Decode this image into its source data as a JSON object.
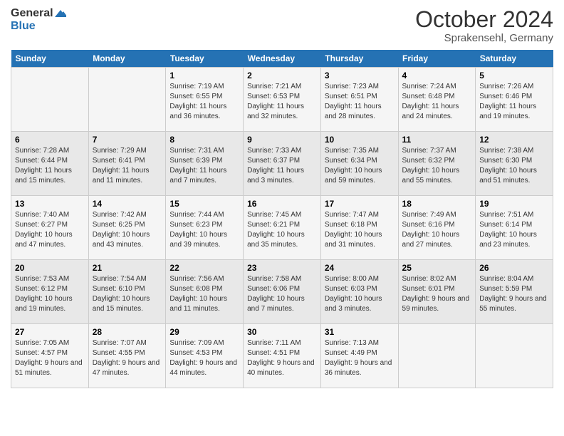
{
  "header": {
    "logo_line1": "General",
    "logo_line2": "Blue",
    "title": "October 2024",
    "subtitle": "Sprakensehl, Germany"
  },
  "days_of_week": [
    "Sunday",
    "Monday",
    "Tuesday",
    "Wednesday",
    "Thursday",
    "Friday",
    "Saturday"
  ],
  "weeks": [
    [
      {
        "day": "",
        "info": ""
      },
      {
        "day": "",
        "info": ""
      },
      {
        "day": "1",
        "info": "Sunrise: 7:19 AM\nSunset: 6:55 PM\nDaylight: 11 hours and 36 minutes."
      },
      {
        "day": "2",
        "info": "Sunrise: 7:21 AM\nSunset: 6:53 PM\nDaylight: 11 hours and 32 minutes."
      },
      {
        "day": "3",
        "info": "Sunrise: 7:23 AM\nSunset: 6:51 PM\nDaylight: 11 hours and 28 minutes."
      },
      {
        "day": "4",
        "info": "Sunrise: 7:24 AM\nSunset: 6:48 PM\nDaylight: 11 hours and 24 minutes."
      },
      {
        "day": "5",
        "info": "Sunrise: 7:26 AM\nSunset: 6:46 PM\nDaylight: 11 hours and 19 minutes."
      }
    ],
    [
      {
        "day": "6",
        "info": "Sunrise: 7:28 AM\nSunset: 6:44 PM\nDaylight: 11 hours and 15 minutes."
      },
      {
        "day": "7",
        "info": "Sunrise: 7:29 AM\nSunset: 6:41 PM\nDaylight: 11 hours and 11 minutes."
      },
      {
        "day": "8",
        "info": "Sunrise: 7:31 AM\nSunset: 6:39 PM\nDaylight: 11 hours and 7 minutes."
      },
      {
        "day": "9",
        "info": "Sunrise: 7:33 AM\nSunset: 6:37 PM\nDaylight: 11 hours and 3 minutes."
      },
      {
        "day": "10",
        "info": "Sunrise: 7:35 AM\nSunset: 6:34 PM\nDaylight: 10 hours and 59 minutes."
      },
      {
        "day": "11",
        "info": "Sunrise: 7:37 AM\nSunset: 6:32 PM\nDaylight: 10 hours and 55 minutes."
      },
      {
        "day": "12",
        "info": "Sunrise: 7:38 AM\nSunset: 6:30 PM\nDaylight: 10 hours and 51 minutes."
      }
    ],
    [
      {
        "day": "13",
        "info": "Sunrise: 7:40 AM\nSunset: 6:27 PM\nDaylight: 10 hours and 47 minutes."
      },
      {
        "day": "14",
        "info": "Sunrise: 7:42 AM\nSunset: 6:25 PM\nDaylight: 10 hours and 43 minutes."
      },
      {
        "day": "15",
        "info": "Sunrise: 7:44 AM\nSunset: 6:23 PM\nDaylight: 10 hours and 39 minutes."
      },
      {
        "day": "16",
        "info": "Sunrise: 7:45 AM\nSunset: 6:21 PM\nDaylight: 10 hours and 35 minutes."
      },
      {
        "day": "17",
        "info": "Sunrise: 7:47 AM\nSunset: 6:18 PM\nDaylight: 10 hours and 31 minutes."
      },
      {
        "day": "18",
        "info": "Sunrise: 7:49 AM\nSunset: 6:16 PM\nDaylight: 10 hours and 27 minutes."
      },
      {
        "day": "19",
        "info": "Sunrise: 7:51 AM\nSunset: 6:14 PM\nDaylight: 10 hours and 23 minutes."
      }
    ],
    [
      {
        "day": "20",
        "info": "Sunrise: 7:53 AM\nSunset: 6:12 PM\nDaylight: 10 hours and 19 minutes."
      },
      {
        "day": "21",
        "info": "Sunrise: 7:54 AM\nSunset: 6:10 PM\nDaylight: 10 hours and 15 minutes."
      },
      {
        "day": "22",
        "info": "Sunrise: 7:56 AM\nSunset: 6:08 PM\nDaylight: 10 hours and 11 minutes."
      },
      {
        "day": "23",
        "info": "Sunrise: 7:58 AM\nSunset: 6:06 PM\nDaylight: 10 hours and 7 minutes."
      },
      {
        "day": "24",
        "info": "Sunrise: 8:00 AM\nSunset: 6:03 PM\nDaylight: 10 hours and 3 minutes."
      },
      {
        "day": "25",
        "info": "Sunrise: 8:02 AM\nSunset: 6:01 PM\nDaylight: 9 hours and 59 minutes."
      },
      {
        "day": "26",
        "info": "Sunrise: 8:04 AM\nSunset: 5:59 PM\nDaylight: 9 hours and 55 minutes."
      }
    ],
    [
      {
        "day": "27",
        "info": "Sunrise: 7:05 AM\nSunset: 4:57 PM\nDaylight: 9 hours and 51 minutes."
      },
      {
        "day": "28",
        "info": "Sunrise: 7:07 AM\nSunset: 4:55 PM\nDaylight: 9 hours and 47 minutes."
      },
      {
        "day": "29",
        "info": "Sunrise: 7:09 AM\nSunset: 4:53 PM\nDaylight: 9 hours and 44 minutes."
      },
      {
        "day": "30",
        "info": "Sunrise: 7:11 AM\nSunset: 4:51 PM\nDaylight: 9 hours and 40 minutes."
      },
      {
        "day": "31",
        "info": "Sunrise: 7:13 AM\nSunset: 4:49 PM\nDaylight: 9 hours and 36 minutes."
      },
      {
        "day": "",
        "info": ""
      },
      {
        "day": "",
        "info": ""
      }
    ]
  ]
}
